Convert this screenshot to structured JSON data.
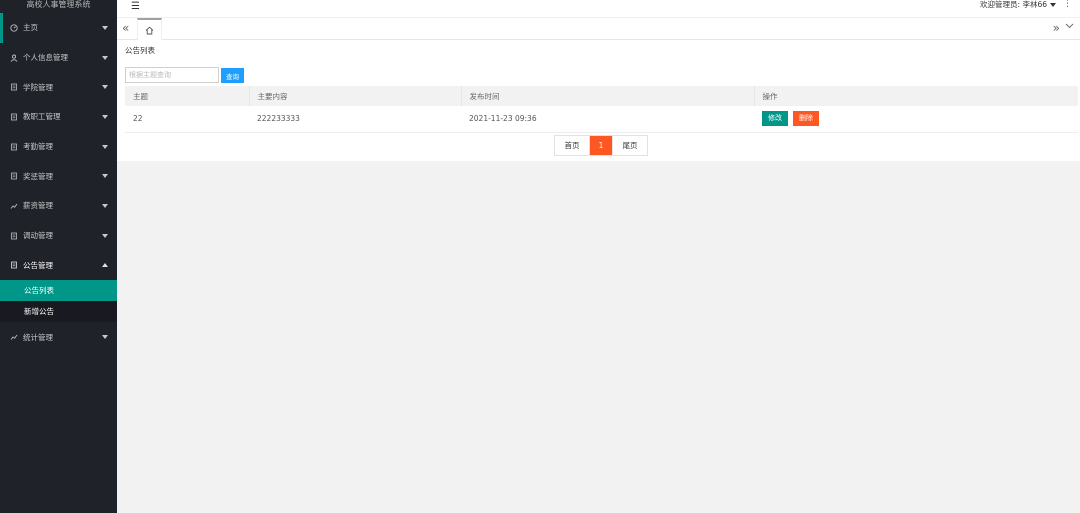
{
  "app": {
    "title": "高校人事管理系统"
  },
  "sidebar": {
    "items": [
      {
        "label": "主页",
        "icon": "dashboard-icon"
      },
      {
        "label": "个人信息管理",
        "icon": "user-icon"
      },
      {
        "label": "学院管理",
        "icon": "list-icon"
      },
      {
        "label": "教职工管理",
        "icon": "list-icon"
      },
      {
        "label": "考勤管理",
        "icon": "list-icon"
      },
      {
        "label": "奖惩管理",
        "icon": "list-icon"
      },
      {
        "label": "薪资管理",
        "icon": "chart-icon"
      },
      {
        "label": "调动管理",
        "icon": "list-icon"
      },
      {
        "label": "公告管理",
        "icon": "list-icon"
      },
      {
        "label": "统计管理",
        "icon": "chart-icon"
      }
    ],
    "submenu": [
      {
        "label": "公告列表"
      },
      {
        "label": "新增公告"
      }
    ]
  },
  "header": {
    "welcome": "欢迎管理员: 李林66"
  },
  "content": {
    "breadcrumb": "公告列表",
    "search": {
      "placeholder": "根据主题查询",
      "button": "查询"
    },
    "table": {
      "headers": [
        "主题",
        "主要内容",
        "发布时间",
        "操作"
      ],
      "rows": [
        {
          "title": "22",
          "content": "222233333",
          "time": "2021-11-23 09:36",
          "edit": "修改",
          "delete": "删除"
        }
      ]
    },
    "pager": {
      "first": "首页",
      "current": "1",
      "last": "尾页"
    }
  },
  "colors": {
    "sidebar_bg": "#20222a",
    "accent": "#009688",
    "primary": "#1e9fff",
    "danger": "#ff5722"
  }
}
